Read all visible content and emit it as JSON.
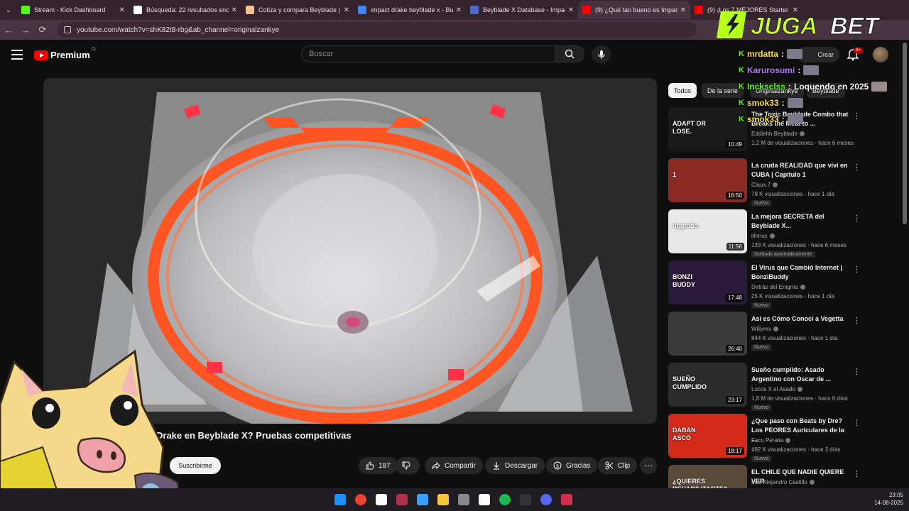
{
  "browser": {
    "tabs": [
      {
        "title": "Stream - Kick Dashboard",
        "favicon_color": "#53fc18",
        "active": false
      },
      {
        "title": "Búsqueda: 22 resultados encontrados",
        "favicon_color": "#ffffff",
        "active": false
      },
      {
        "title": "Cotiza y compara Beyblade | Solotodo",
        "favicon_color": "#f5c19a",
        "active": false
      },
      {
        "title": "impact drake beyblade x - Buscar con Google",
        "favicon_color": "#4285f4",
        "active": false
      },
      {
        "title": "Beyblade X Database - Impact Drake",
        "favicon_color": "#5566cc",
        "active": false
      },
      {
        "title": "(9) ¿Qué tan bueno es Impact Drake?",
        "favicon_color": "#ff0000",
        "active": true
      },
      {
        "title": "(9) ¡Los 7 MEJORES Starter Packs!",
        "favicon_color": "#ff0000",
        "active": false
      }
    ],
    "url": "youtube.com/watch?v=shK82t8-rbg&ab_channel=originalzankye"
  },
  "masthead": {
    "logo_text": "Premium",
    "logo_region": "CL",
    "search_placeholder": "Buscar",
    "create_label": "Crear",
    "notif_count": "9+"
  },
  "video": {
    "title": "Drake en Beyblade X? Pruebas competitivas",
    "subscribe_label": "Suscribirme",
    "likes": "187",
    "share_label": "Compartir",
    "download_label": "Descargar",
    "thanks_label": "Gracias",
    "clip_label": "Clip"
  },
  "chips": [
    {
      "label": "Todos",
      "selected": true
    },
    {
      "label": "De la serie",
      "selected": false
    },
    {
      "label": "Originalzankye",
      "selected": false
    },
    {
      "label": "Beyblade",
      "selected": false
    }
  ],
  "recommendations": [
    {
      "title": "The Toxic Beyblade Combo that Breaks the Meta to ...",
      "thumb_text": "ADAPT OR LOSE.",
      "thumb_color": "#1a1a1a",
      "duration": "10:49",
      "channel": "Eddiehh Beyblade",
      "meta": "1,2 M de visualizaciones · hace 6 meses",
      "badge": ""
    },
    {
      "title": "La cruda REALIDAD que viví en CUBA | Capítulo 1",
      "thumb_text": "1",
      "thumb_color": "#8a2a22",
      "duration": "16:50",
      "channel": "Claux.7",
      "meta": "78 K visualizaciones · hace 1 día",
      "badge": "Nuevo"
    },
    {
      "title": "La mejora SECRETA del Beyblade X...",
      "thumb_text": "upgrade.",
      "thumb_color": "#e8e8e8",
      "duration": "11:56",
      "channel": "illnnuc",
      "meta": "133 K visualizaciones · hace 6 meses",
      "badge": "Doblado automáticamente"
    },
    {
      "title": "El Virus que Cambió Internet | BonziBuddy",
      "thumb_text": "BONZI BUDDY",
      "thumb_color": "#2a1a3a",
      "duration": "17:48",
      "channel": "Detrás del Enigma",
      "meta": "25 K visualizaciones · hace 1 día",
      "badge": "Nuevo"
    },
    {
      "title": "Así es Cómo Conocí a Vegetta",
      "thumb_text": "",
      "thumb_color": "#3a3a3a",
      "duration": "26:40",
      "channel": "Willyrex",
      "meta": "844 K visualizaciones · hace 1 día",
      "badge": "Nuevo"
    },
    {
      "title": "Sueño cumplido: Asado Argentino con Oscar de ...",
      "thumb_text": "SUEÑO CUMPLIDO",
      "thumb_color": "#2c2c2c",
      "duration": "23:17",
      "channel": "Locos X el Asado",
      "meta": "1,6 M de visualizaciones · hace 6 días",
      "badge": "Nuevo"
    },
    {
      "title": "¿Que paso con Beats by Dre? Los PEORES Auriculares de la ...",
      "thumb_text": "DABAN ASCO",
      "thumb_color": "#d42a1a",
      "duration": "18:17",
      "channel": "Facu Peralta",
      "meta": "492 K visualizaciones · hace 3 días",
      "badge": "Nuevo"
    },
    {
      "title": "EL CHILE QUE NADIE QUIERE VER",
      "thumb_text": "¿QUIERES REHABILITARTE?",
      "thumb_color": "#5a4a3a",
      "duration": "",
      "channel": "Luis Alejandro Castillo",
      "meta": "",
      "badge": ""
    }
  ],
  "overlay": {
    "sponsor": "JUGABET",
    "chat": [
      {
        "user": "mrdatta",
        "color": "#ffe14d",
        "message": ""
      },
      {
        "user": "Karurosumi",
        "color": "#b57aff",
        "message": ""
      },
      {
        "user": "Incksclss",
        "color": "#53fc18",
        "message": "Loquendo en 2025"
      },
      {
        "user": "smok33",
        "color": "#ffe14d",
        "message": ""
      },
      {
        "user": "smok33",
        "color": "#ffe14d",
        "message": ""
      }
    ]
  },
  "taskbar": {
    "time": "23:05",
    "date": "14-08-2025",
    "icon_colors": [
      "#1e90ff",
      "#ea4335",
      "#ffffff",
      "#b0304a",
      "#3aa0ff",
      "#f5c542",
      "#888888",
      "#ffffff",
      "#1db954",
      "#333333",
      "#5865f2",
      "#d0304a"
    ]
  }
}
